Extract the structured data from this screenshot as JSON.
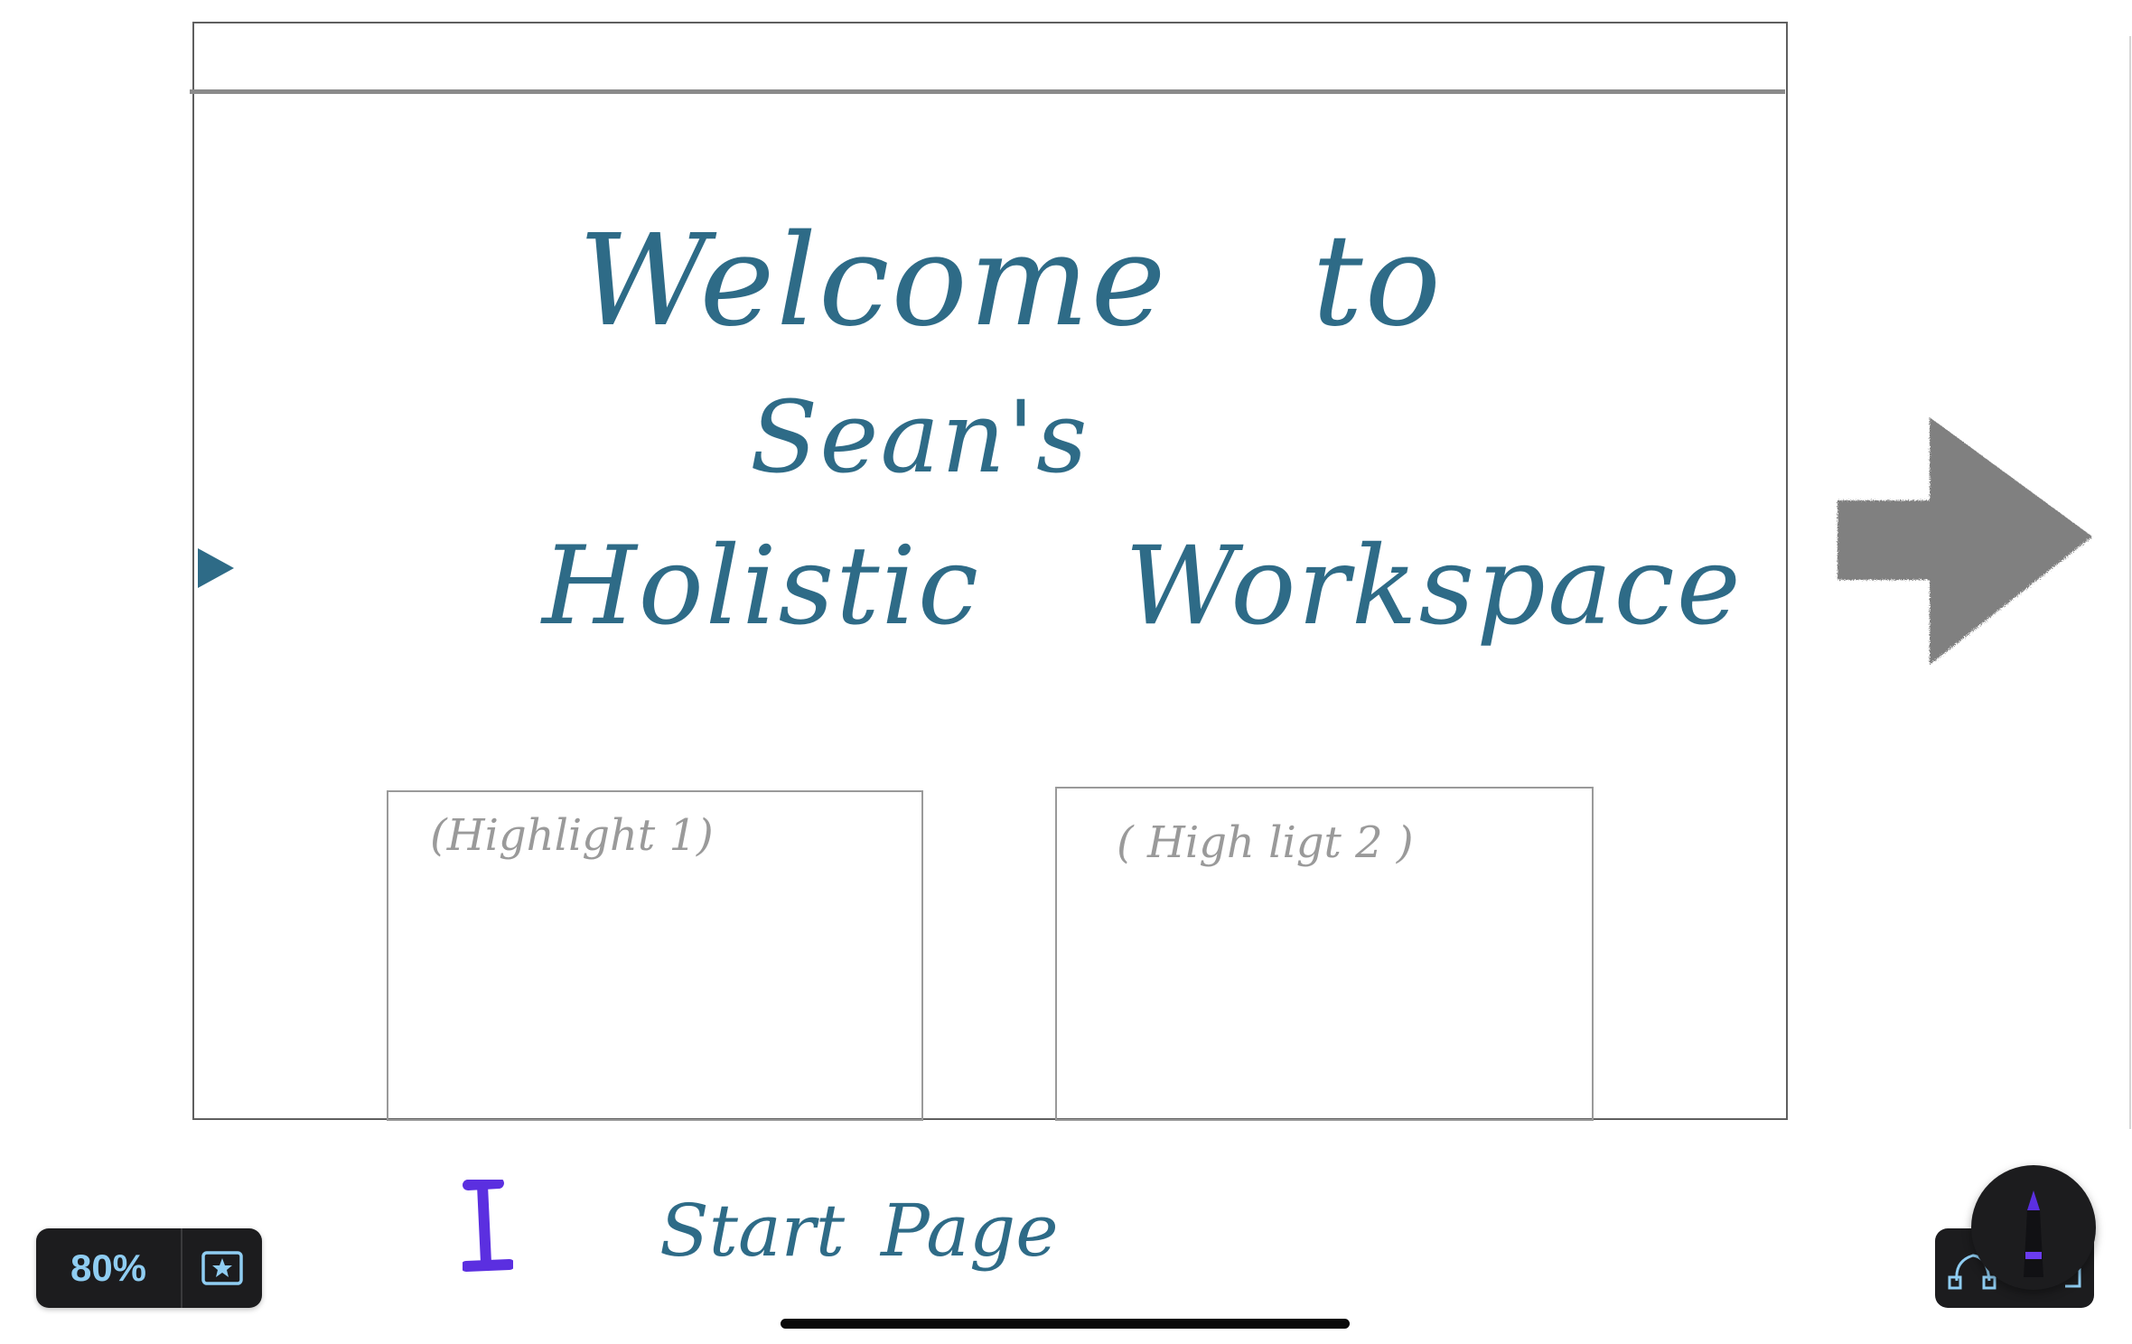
{
  "canvas": {
    "title": {
      "line1_word1": "Welcome",
      "line1_word2": "to",
      "line2": "Sean's",
      "line3_word1": "Holistic",
      "line3_word2": "Workspace"
    },
    "highlights": [
      {
        "label": "(Highlight 1)"
      },
      {
        "label": "( High ligt 2 )"
      }
    ],
    "page_number": "1",
    "page_caption_word1": "Start",
    "page_caption_word2": "Page"
  },
  "zoom": {
    "value": "80%"
  },
  "icons": {
    "bookmark": "star-bookmark-icon",
    "shape_tool": "shape-tool-icon",
    "pen": "pen-icon",
    "next_arrow": "right-arrow-drawing",
    "side_marker": "triangle-marker-icon"
  },
  "colors": {
    "ink_blue": "#2e6b87",
    "ink_purple": "#5b2fe0",
    "highlight_gray": "#9a9a9a",
    "arrow_gray": "#808080",
    "toolbar_dark": "#1c1c1e",
    "zoom_text": "#8fcdf2"
  }
}
